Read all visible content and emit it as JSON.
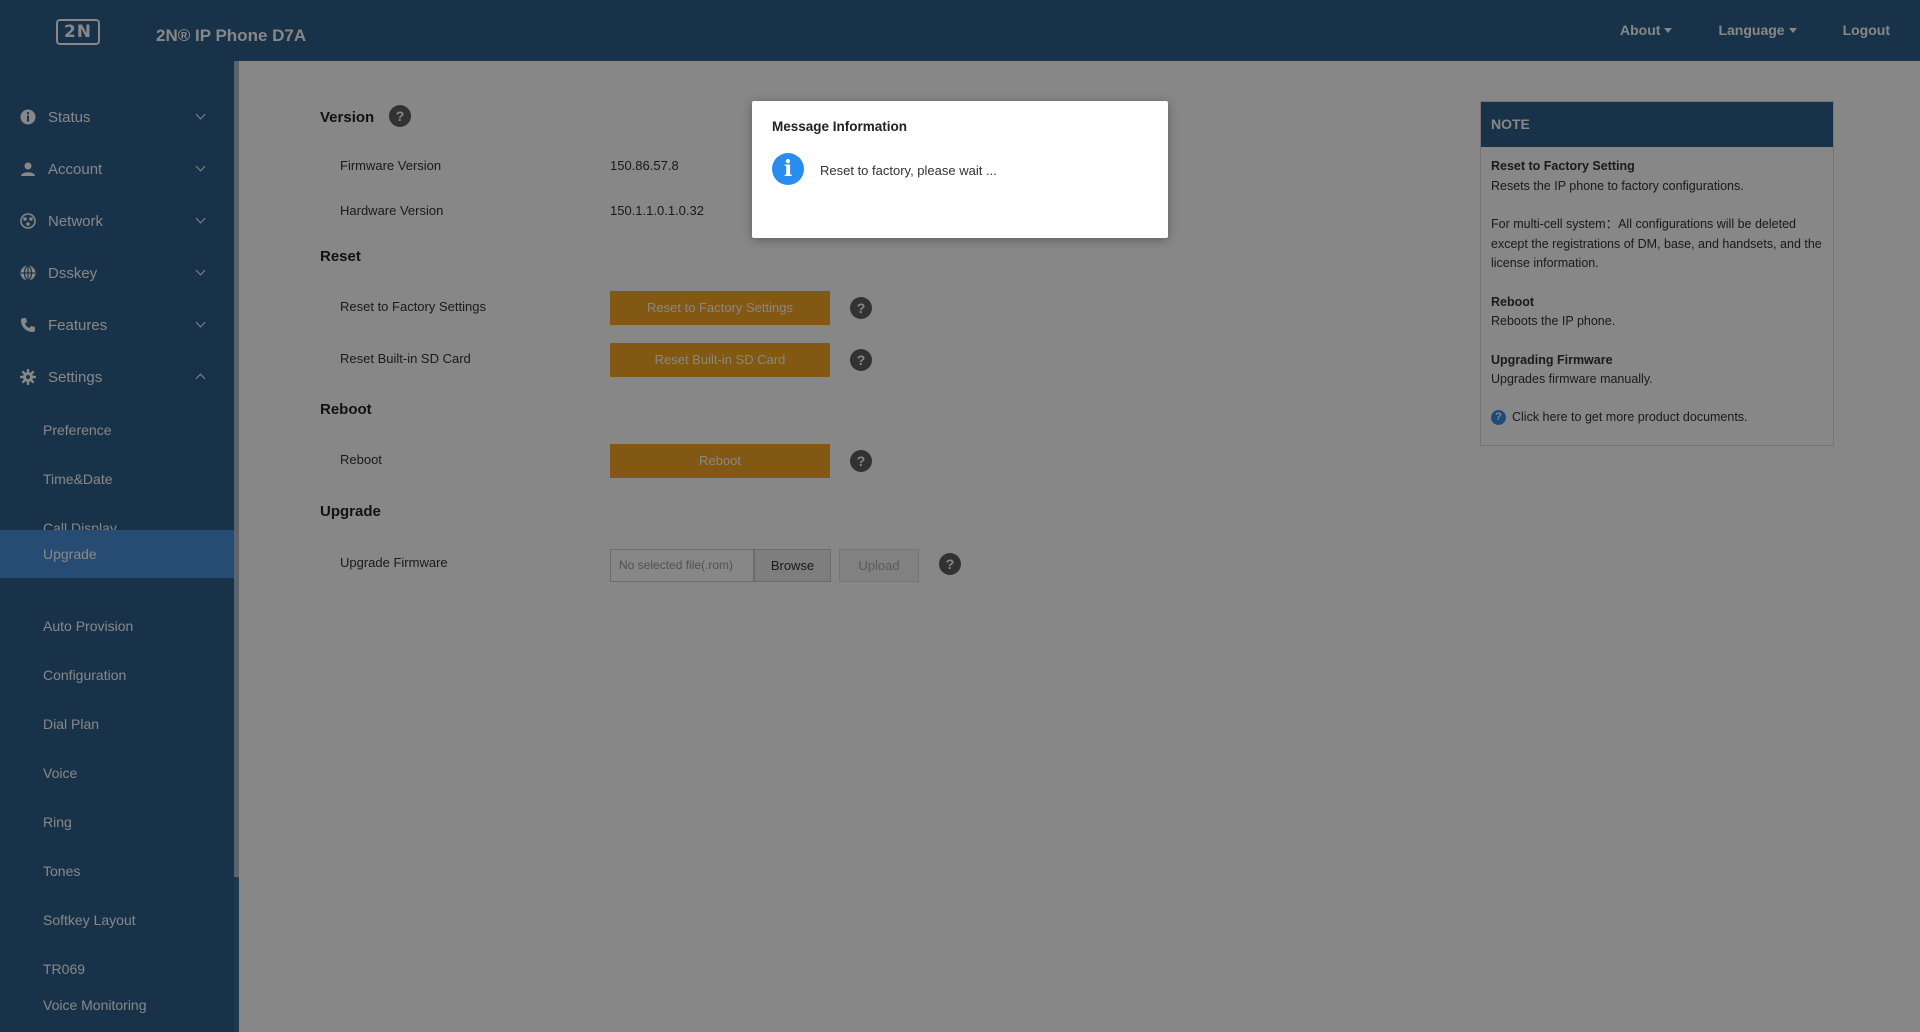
{
  "header": {
    "logo_text": "2N",
    "product_title": "2N® IP Phone D7A",
    "menu": [
      {
        "label": "About",
        "has_caret": true
      },
      {
        "label": "Language",
        "has_caret": true
      },
      {
        "label": "Logout",
        "has_caret": false
      }
    ]
  },
  "sidebar": {
    "sections": [
      {
        "label": "Status",
        "icon": "info-icon",
        "expanded": false
      },
      {
        "label": "Account",
        "icon": "user-icon",
        "expanded": false
      },
      {
        "label": "Network",
        "icon": "network-icon",
        "expanded": false
      },
      {
        "label": "Dsskey",
        "icon": "globe-icon",
        "expanded": false
      },
      {
        "label": "Features",
        "icon": "phone-icon",
        "expanded": false
      },
      {
        "label": "Settings",
        "icon": "gear-icon",
        "expanded": true
      }
    ],
    "settings_items": [
      {
        "label": "Preference",
        "active": false
      },
      {
        "label": "Time&Date",
        "active": false
      },
      {
        "label": "Call Display",
        "active": false
      },
      {
        "label": "Upgrade",
        "active": true
      },
      {
        "label": "Auto Provision",
        "active": false
      },
      {
        "label": "Configuration",
        "active": false
      },
      {
        "label": "Dial Plan",
        "active": false
      },
      {
        "label": "Voice",
        "active": false
      },
      {
        "label": "Ring",
        "active": false
      },
      {
        "label": "Tones",
        "active": false
      },
      {
        "label": "Softkey Layout",
        "active": false
      },
      {
        "label": "TR069",
        "active": false
      },
      {
        "label": "Voice Monitoring",
        "active": false
      }
    ]
  },
  "main": {
    "version": {
      "title": "Version",
      "firmware_label": "Firmware Version",
      "firmware_value": "150.86.57.8",
      "hardware_label": "Hardware Version",
      "hardware_value": "150.1.1.0.1.0.32"
    },
    "reset": {
      "title": "Reset",
      "factory_label": "Reset to Factory Settings",
      "factory_button": "Reset to Factory Settings",
      "sd_label": "Reset Built-in SD Card",
      "sd_button": "Reset Built-in SD Card"
    },
    "reboot": {
      "title": "Reboot",
      "label": "Reboot",
      "button": "Reboot"
    },
    "upgrade": {
      "title": "Upgrade",
      "label": "Upgrade Firmware",
      "file_placeholder": "No selected file(.rom)",
      "browse_button": "Browse",
      "upload_button": "Upload"
    },
    "help_glyph": "?"
  },
  "note": {
    "header": "NOTE",
    "factory_title": "Reset to Factory Setting",
    "factory_text": "Resets the IP phone to factory configurations.",
    "multicell_text": "For multi-cell system：All configurations will be deleted except the registrations of DM, base, and handsets, and the license information.",
    "reboot_title": "Reboot",
    "reboot_text": "Reboots the IP phone.",
    "upgrade_title": "Upgrading Firmware",
    "upgrade_text": "Upgrades firmware manually.",
    "link_text": "Click here to get more product documents."
  },
  "modal": {
    "title": "Message Information",
    "icon_glyph": "i",
    "message": "Reset to factory, please wait ..."
  },
  "colors": {
    "brand": "#2d5f8a",
    "active_item": "#4a90d9",
    "button_orange": "#f5a623",
    "info_blue": "#2b8cf0"
  }
}
